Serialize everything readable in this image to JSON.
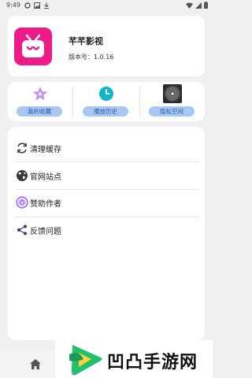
{
  "status_bar": {
    "time": "9:49"
  },
  "app": {
    "name": "芊芊影视",
    "version": "版本号：1.0.16"
  },
  "quick_actions": [
    {
      "label": "我的收藏",
      "icon": "star-icon"
    },
    {
      "label": "播放历史",
      "icon": "clock-icon"
    },
    {
      "label": "隐私空间",
      "icon": "vinyl-icon"
    }
  ],
  "menu": [
    {
      "label": "清理缓存",
      "icon": "refresh-icon"
    },
    {
      "label": "官网站点",
      "icon": "globe-icon"
    },
    {
      "label": "赞助作者",
      "icon": "sponsor-icon"
    },
    {
      "label": "反馈问题",
      "icon": "share-icon"
    }
  ],
  "bottom_nav": {
    "home_icon": "home-icon"
  },
  "watermark": {
    "text": "凹凸手游网"
  },
  "colors": {
    "brand_pink": "#f0198a",
    "label_blue": "#1e5fb4",
    "pill_bg": "#a9c8ef",
    "watermark_green": "#21c06a"
  }
}
